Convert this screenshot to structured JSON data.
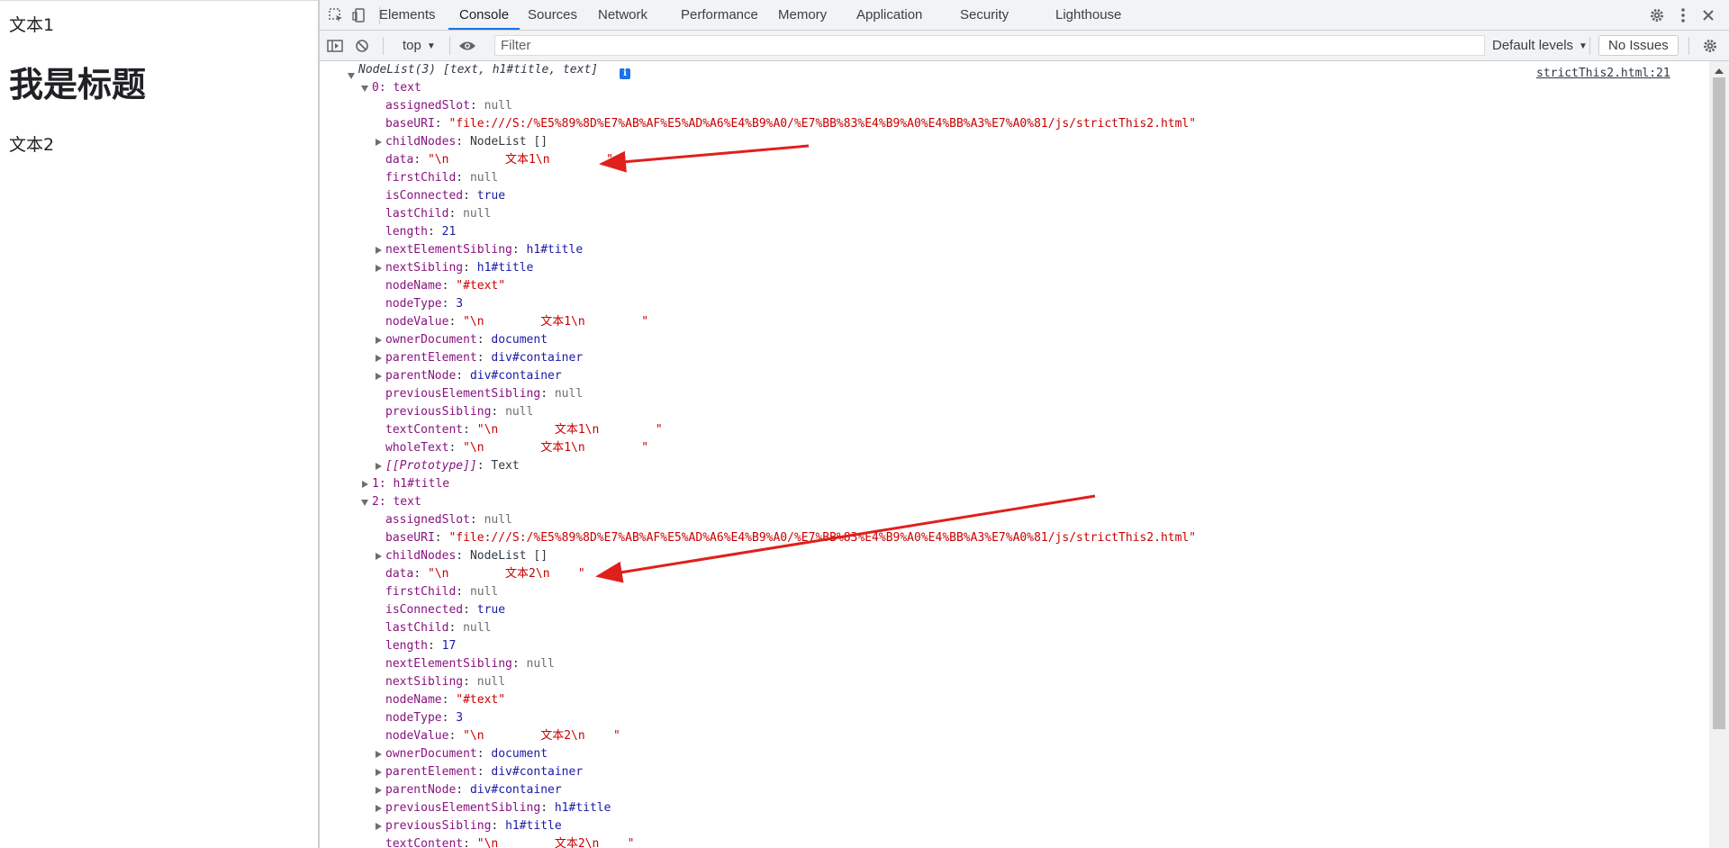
{
  "page": {
    "text1": "文本1",
    "heading": "我是标题",
    "text2": "文本2"
  },
  "tabs": [
    "Elements",
    "Console",
    "Sources",
    "Network",
    "Performance",
    "Memory",
    "Application",
    "Security",
    "Lighthouse"
  ],
  "active_tab": "Console",
  "console_toolbar": {
    "context": "top",
    "filter_placeholder": "Filter",
    "levels": "Default levels",
    "issues": "No Issues"
  },
  "log": {
    "source": "strictThis2.html:21",
    "header": {
      "name": "NodeList(3)",
      "preview": "[text, h1#title, text]"
    },
    "node0": {
      "label": "0: text",
      "props": [
        {
          "key": "assignedSlot",
          "value": "null",
          "kind": "dim",
          "expandable": false
        },
        {
          "key": "baseURI",
          "value": "\"file:///S:/%E5%89%8D%E7%AB%AF%E5%AD%A6%E4%B9%A0/%E7%BB%83%E4%B9%A0%E4%BB%A3%E7%A0%81/js/strictThis2.html\"",
          "kind": "str",
          "expandable": false
        },
        {
          "key": "childNodes",
          "value": "NodeList []",
          "kind": "plain",
          "expandable": true
        },
        {
          "key": "data",
          "value": "\"\\n        文本1\\n        \"",
          "kind": "str",
          "expandable": false
        },
        {
          "key": "firstChild",
          "value": "null",
          "kind": "dim",
          "expandable": false
        },
        {
          "key": "isConnected",
          "value": "true",
          "kind": "bool",
          "expandable": false
        },
        {
          "key": "lastChild",
          "value": "null",
          "kind": "dim",
          "expandable": false
        },
        {
          "key": "length",
          "value": "21",
          "kind": "num",
          "expandable": false
        },
        {
          "key": "nextElementSibling",
          "value": "h1#title",
          "kind": "node",
          "expandable": true
        },
        {
          "key": "nextSibling",
          "value": "h1#title",
          "kind": "node",
          "expandable": true
        },
        {
          "key": "nodeName",
          "value": "\"#text\"",
          "kind": "str",
          "expandable": false
        },
        {
          "key": "nodeType",
          "value": "3",
          "kind": "num",
          "expandable": false
        },
        {
          "key": "nodeValue",
          "value": "\"\\n        文本1\\n        \"",
          "kind": "str",
          "expandable": false
        },
        {
          "key": "ownerDocument",
          "value": "document",
          "kind": "node",
          "expandable": true
        },
        {
          "key": "parentElement",
          "value": "div#container",
          "kind": "node",
          "expandable": true
        },
        {
          "key": "parentNode",
          "value": "div#container",
          "kind": "node",
          "expandable": true
        },
        {
          "key": "previousElementSibling",
          "value": "null",
          "kind": "dim",
          "expandable": false
        },
        {
          "key": "previousSibling",
          "value": "null",
          "kind": "dim",
          "expandable": false
        },
        {
          "key": "textContent",
          "value": "\"\\n        文本1\\n        \"",
          "kind": "str",
          "expandable": false
        },
        {
          "key": "wholeText",
          "value": "\"\\n        文本1\\n        \"",
          "kind": "str",
          "expandable": false
        },
        {
          "key": "[[Prototype]]",
          "value": "Text",
          "kind": "plain",
          "expandable": true,
          "italic": true
        }
      ]
    },
    "node1": {
      "label": "1: h1#title"
    },
    "node2": {
      "label": "2: text",
      "props": [
        {
          "key": "assignedSlot",
          "value": "null",
          "kind": "dim",
          "expandable": false
        },
        {
          "key": "baseURI",
          "value": "\"file:///S:/%E5%89%8D%E7%AB%AF%E5%AD%A6%E4%B9%A0/%E7%BB%83%E4%B9%A0%E4%BB%A3%E7%A0%81/js/strictThis2.html\"",
          "kind": "str",
          "expandable": false
        },
        {
          "key": "childNodes",
          "value": "NodeList []",
          "kind": "plain",
          "expandable": true
        },
        {
          "key": "data",
          "value": "\"\\n        文本2\\n    \"",
          "kind": "str",
          "expandable": false
        },
        {
          "key": "firstChild",
          "value": "null",
          "kind": "dim",
          "expandable": false
        },
        {
          "key": "isConnected",
          "value": "true",
          "kind": "bool",
          "expandable": false
        },
        {
          "key": "lastChild",
          "value": "null",
          "kind": "dim",
          "expandable": false
        },
        {
          "key": "length",
          "value": "17",
          "kind": "num",
          "expandable": false
        },
        {
          "key": "nextElementSibling",
          "value": "null",
          "kind": "dim",
          "expandable": false
        },
        {
          "key": "nextSibling",
          "value": "null",
          "kind": "dim",
          "expandable": false
        },
        {
          "key": "nodeName",
          "value": "\"#text\"",
          "kind": "str",
          "expandable": false
        },
        {
          "key": "nodeType",
          "value": "3",
          "kind": "num",
          "expandable": false
        },
        {
          "key": "nodeValue",
          "value": "\"\\n        文本2\\n    \"",
          "kind": "str",
          "expandable": false
        },
        {
          "key": "ownerDocument",
          "value": "document",
          "kind": "node",
          "expandable": true
        },
        {
          "key": "parentElement",
          "value": "div#container",
          "kind": "node",
          "expandable": true
        },
        {
          "key": "parentNode",
          "value": "div#container",
          "kind": "node",
          "expandable": true
        },
        {
          "key": "previousElementSibling",
          "value": "h1#title",
          "kind": "node",
          "expandable": true
        },
        {
          "key": "previousSibling",
          "value": "h1#title",
          "kind": "node",
          "expandable": true
        },
        {
          "key": "textContent",
          "value": "\"\\n        文本2\\n    \"",
          "kind": "str",
          "expandable": false
        }
      ]
    }
  },
  "colors": {
    "annotation_arrow": "#e0201b",
    "active_tab_underline": "#1a73e8"
  },
  "icons": [
    "inspect-icon",
    "device-toggle-icon",
    "settings-icon",
    "more-menu-icon",
    "close-icon",
    "sidebar-toggle-icon",
    "clear-console-icon",
    "eye-icon",
    "console-settings-icon",
    "info-icon"
  ]
}
